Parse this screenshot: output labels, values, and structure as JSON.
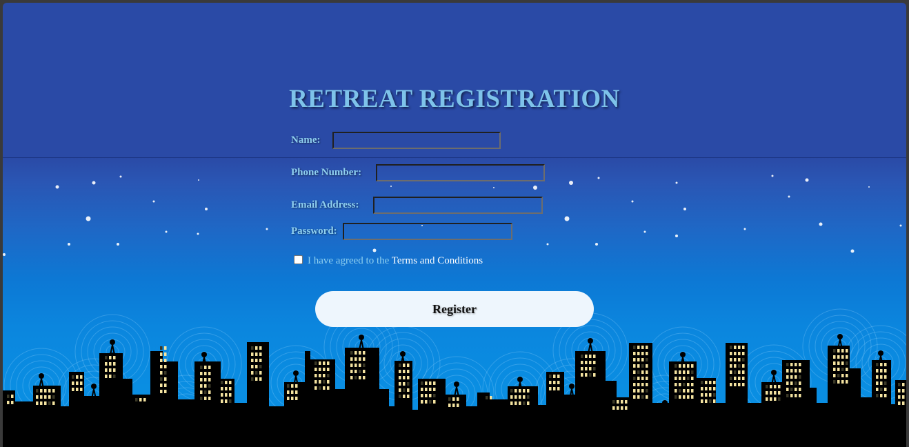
{
  "title": "RETREAT REGISTRATION",
  "form": {
    "name_label": "Name:",
    "name_value": "",
    "phone_label": "Phone Number:",
    "phone_value": "",
    "email_label": "Email Address:",
    "email_value": "",
    "password_label": "Password:",
    "password_value": "",
    "agree_checked": false,
    "agree_text": "I have agreed to the ",
    "terms_link": "Terms and Conditions",
    "register_label": "Register"
  },
  "colors": {
    "background_top": "#2a4aa6",
    "background_bottom": "#0a8ee2",
    "title": "#7ec3ea",
    "label": "#8fd0f0",
    "button": "#eef6fd",
    "skyline": "#000000",
    "window_light": "#f4e3a0"
  }
}
